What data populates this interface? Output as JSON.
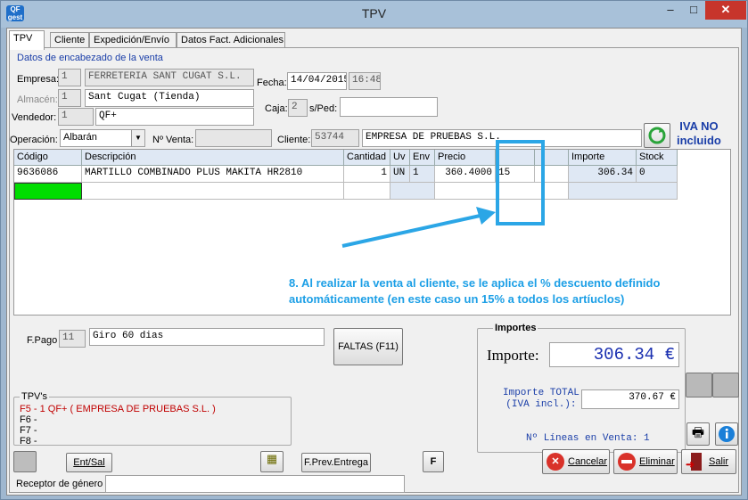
{
  "window": {
    "title": "TPV",
    "logo": "QF",
    "minimize": "–",
    "maximize": "□",
    "close": "✕"
  },
  "tabs": [
    "TPV",
    "Cliente",
    "Expedición/Envío",
    "Datos Fact. Adicionales"
  ],
  "header_section": {
    "title": "Datos de encabezado de la venta",
    "empresa_label": "Empresa:",
    "empresa_code": "1",
    "empresa_name": "FERRETERIA SANT CUGAT S.L.",
    "almacen_label": "Almacén:",
    "almacen_code": "1",
    "almacen_name": "Sant Cugat (Tienda)",
    "vendedor_label": "Vendedor:",
    "vendedor_code": "1",
    "vendedor_name": "QF+",
    "fecha_label": "Fecha:",
    "fecha": "14/04/2015",
    "hora": "16:48",
    "caja_label": "Caja:",
    "caja": "2",
    "sped_label": "s/Ped:",
    "sped": "",
    "operacion_label": "Operación:",
    "operacion": "Albarán",
    "nventa_label": "Nº Venta:",
    "nventa": "",
    "cliente_label": "Cliente:",
    "cliente_code": "53744",
    "cliente_name": "EMPRESA DE PRUEBAS S.L.",
    "iva_line1": "IVA NO",
    "iva_line2": "incluido"
  },
  "grid": {
    "columns": [
      "Código",
      "Descripción",
      "Cantidad",
      "Uv",
      "Env",
      "Precio",
      "",
      "",
      "",
      "Importe",
      "Stock"
    ],
    "rows": [
      [
        "9636086",
        "MARTILLO COMBINADO PLUS MAKITA HR2810",
        "1",
        "UN",
        "1",
        "360.4000",
        "15",
        "",
        "",
        "306.34",
        "0"
      ]
    ]
  },
  "annotation": {
    "number": "8.",
    "text": "Al realizar la venta al cliente, se le aplica el % descuento definido automáticamente (en este caso un 15% a todos los artíuclos)"
  },
  "payment": {
    "label": "F.Pago",
    "code": "11",
    "name": "Giro 60 dias"
  },
  "faltas_button": "FALTAS (F11)",
  "importes": {
    "title": "Importes",
    "importe_label": "Importe:",
    "importe_value": "306.34 €",
    "total_label_1": "Importe TOTAL",
    "total_label_2": "(IVA incl.):",
    "total_value": "370.67 €"
  },
  "tpvs": {
    "title": "TPV's",
    "lines": [
      "F5 - 1 QF+ ( EMPRESA DE PRUEBAS S.L. )",
      "F6 -",
      "F7 -",
      "F8 -"
    ]
  },
  "lines_count": "Nº Líneas en Venta: 1",
  "bottom_buttons": {
    "entsal": "Ent/Sal",
    "prev": "F.Prev.Entrega",
    "f": "F",
    "cancelar": "Cancelar",
    "eliminar": "Eliminar",
    "salir": "Salir"
  },
  "receptor_label": "Receptor de género",
  "colors": {
    "accent": "#1c9fe6",
    "iva": "#1a3ea8",
    "importe": "#1a2fb0",
    "tpv_active": "#c00000",
    "new_row": "#00dd00"
  }
}
